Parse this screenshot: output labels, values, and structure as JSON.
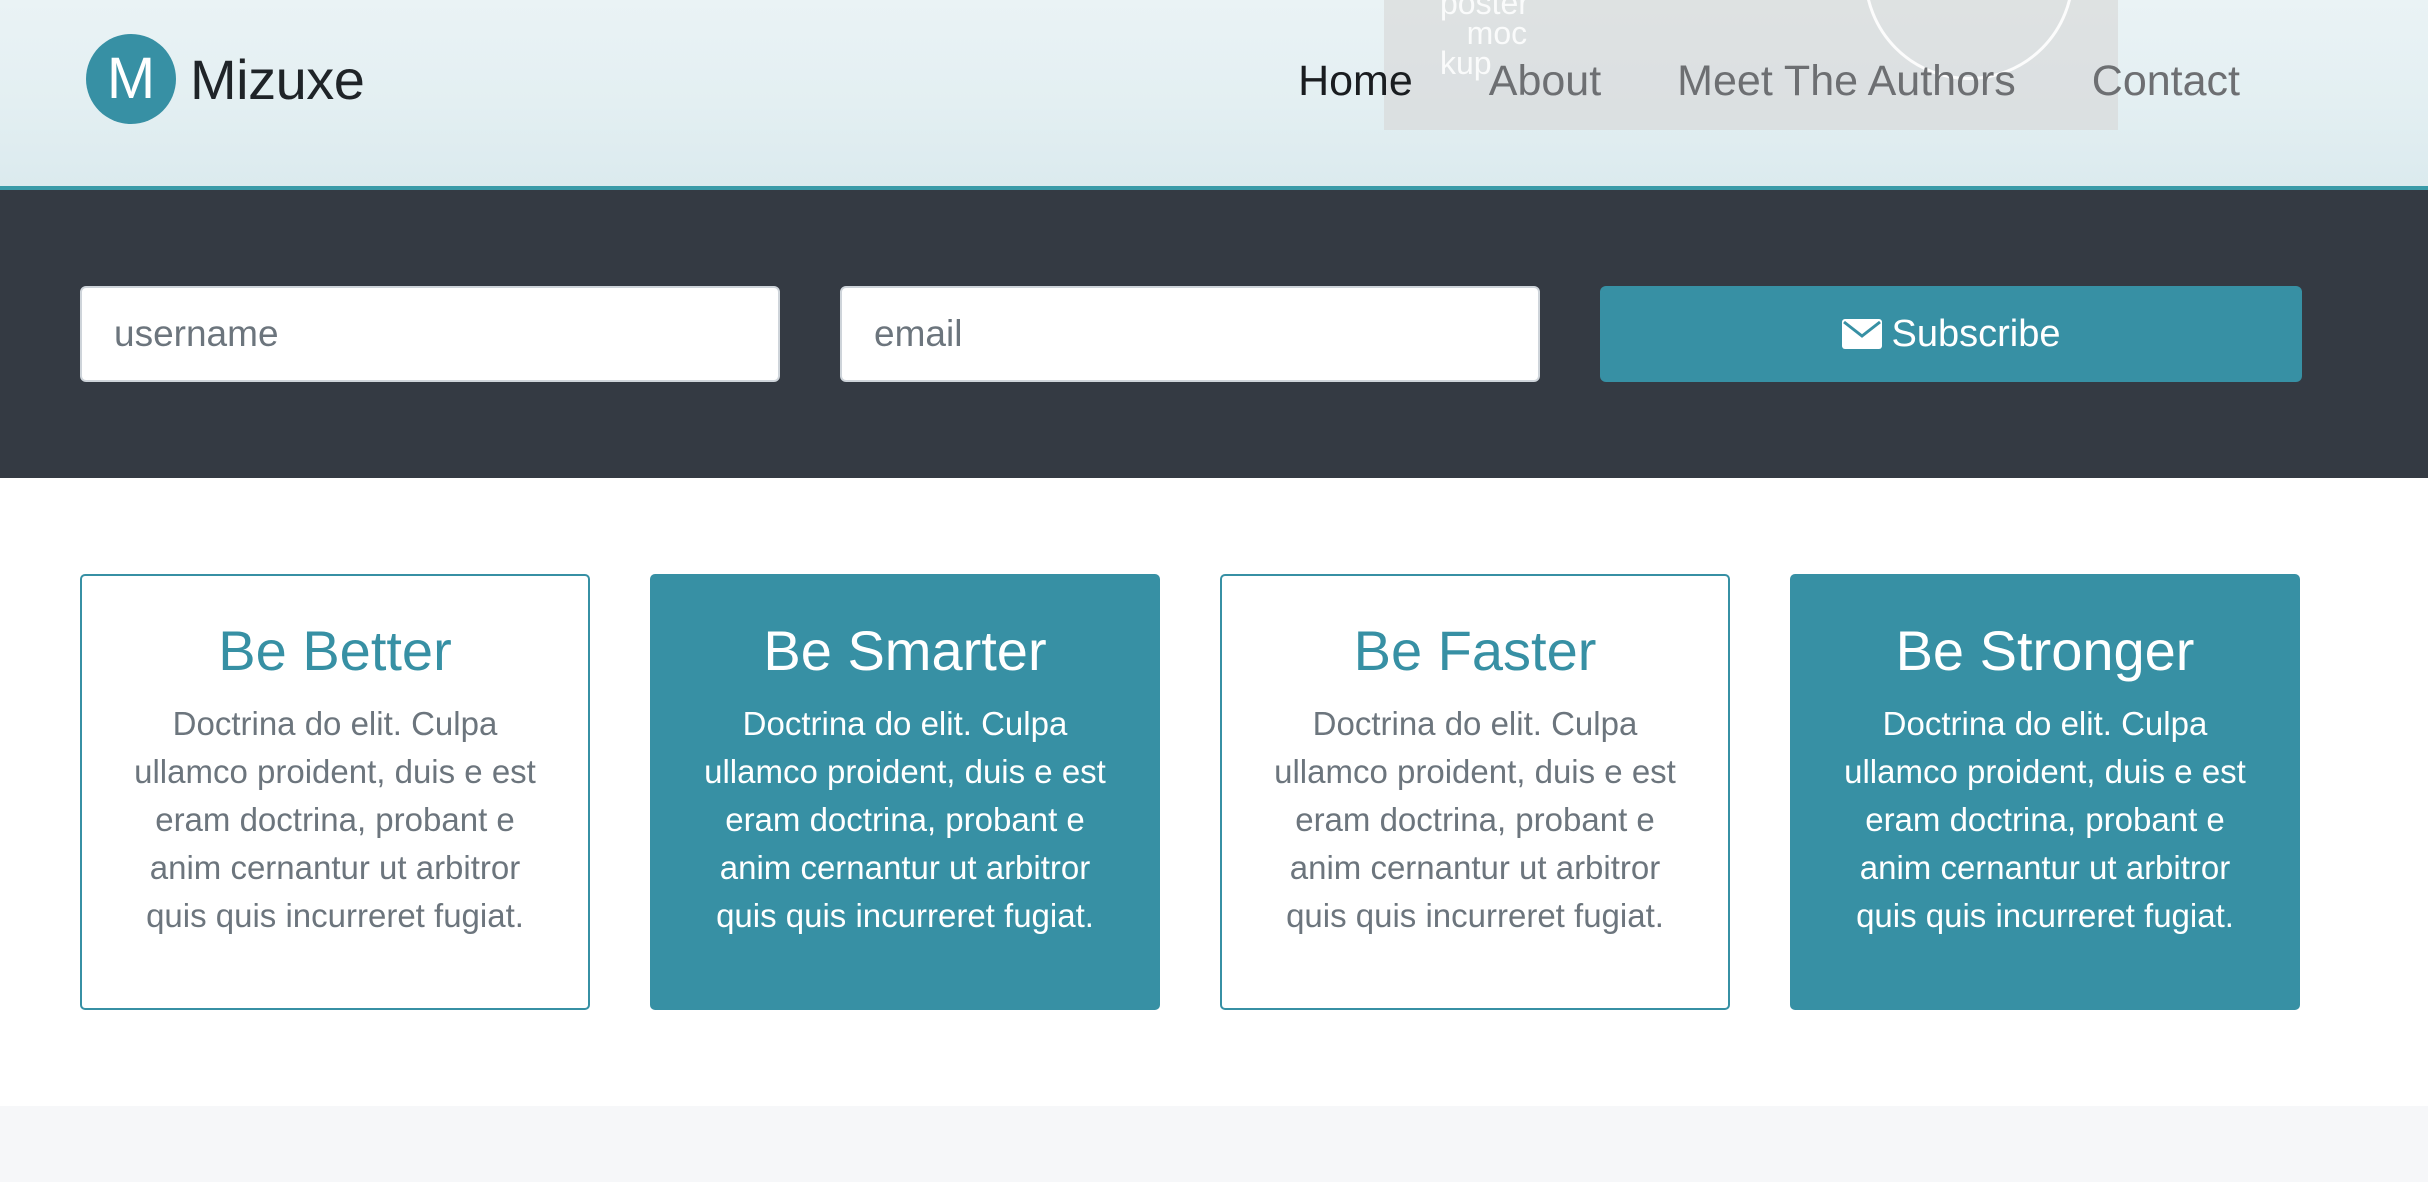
{
  "brand": {
    "logo_letter": "M",
    "name": "Mizuxe"
  },
  "poster_mock": {
    "text": "poster\nmoc\nkup"
  },
  "nav": {
    "items": [
      {
        "label": "Home",
        "active": true
      },
      {
        "label": "About",
        "active": false
      },
      {
        "label": "Meet The Authors",
        "active": false
      },
      {
        "label": "Contact",
        "active": false
      }
    ]
  },
  "subscribe": {
    "username_placeholder": "username",
    "email_placeholder": "email",
    "button_label": "Subscribe",
    "button_icon": "envelope-icon"
  },
  "cards": [
    {
      "title": "Be Better",
      "text": "Doctrina do elit. Culpa ullamco proident, duis e est eram doctrina, probant e anim cernantur ut arbitror quis quis incurreret fugiat."
    },
    {
      "title": "Be Smarter",
      "text": "Doctrina do elit. Culpa ullamco proident, duis e est eram doctrina, probant e anim cernantur ut arbitror quis quis incurreret fugiat."
    },
    {
      "title": "Be Faster",
      "text": "Doctrina do elit. Culpa ullamco proident, duis e est eram doctrina, probant e anim cernantur ut arbitror quis quis incurreret fugiat."
    },
    {
      "title": "Be Stronger",
      "text": "Doctrina do elit. Culpa ullamco proident, duis e est eram doctrina, probant e anim cernantur ut arbitror quis quis incurreret fugiat."
    }
  ],
  "colors": {
    "accent": "#3790a4",
    "dark_band": "#343a43",
    "header_bg": "#e3eff2"
  }
}
